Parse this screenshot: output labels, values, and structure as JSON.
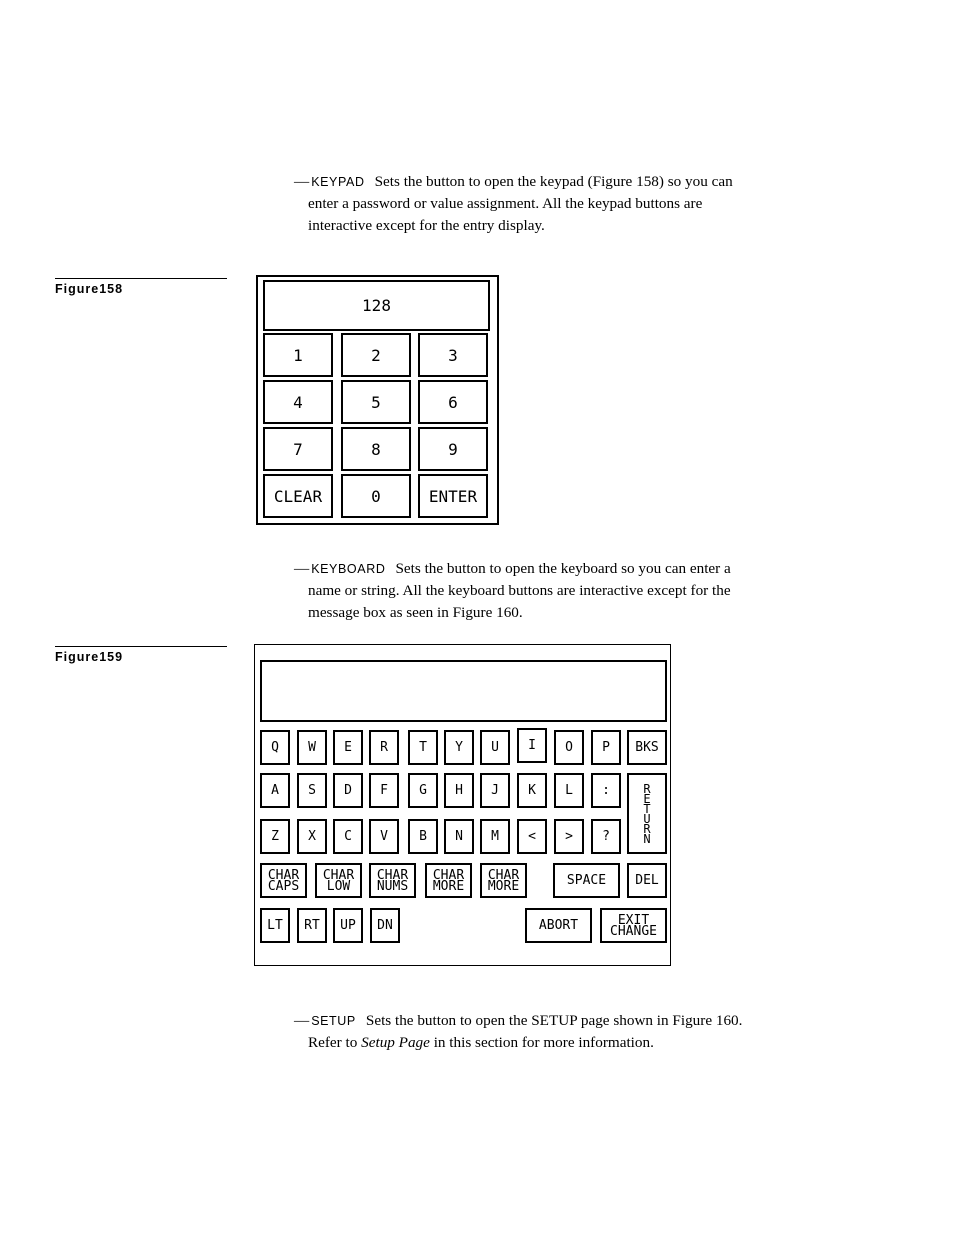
{
  "paragraphs": {
    "keypad": {
      "keyword": "KEYPAD",
      "lines": [
        "Sets the button to open the keypad (Figure 158) so you can",
        "enter a password or value assignment. All the keypad buttons are",
        "interactive except for the entry display."
      ]
    },
    "keyboard": {
      "keyword": "KEYBOARD",
      "lines": [
        "Sets the button to open the keyboard so you can enter a",
        "name or string. All the keyboard buttons are interactive except for the",
        "message box as seen in Figure 160."
      ]
    },
    "setup": {
      "keyword": "SETUP",
      "line1": "Sets the button to open the SETUP page shown in Figure 160.",
      "line2_pre": "Refer to ",
      "line2_italic": "Setup Page",
      "line2_post": " in this section for more information."
    }
  },
  "dash": "—",
  "figures": {
    "fig158": "Figure158",
    "fig159": "Figure159"
  },
  "keypad": {
    "display_value": "128",
    "keys": [
      "1",
      "2",
      "3",
      "4",
      "5",
      "6",
      "7",
      "8",
      "9",
      "CLEAR",
      "0",
      "ENTER"
    ]
  },
  "keyboard": {
    "message": "",
    "row1": [
      "Q",
      "W",
      "E",
      "R",
      "T",
      "Y",
      "U",
      "I",
      "O",
      "P",
      "BKS"
    ],
    "row2": [
      "A",
      "S",
      "D",
      "F",
      "G",
      "H",
      "J",
      "K",
      "L",
      ":"
    ],
    "row3": [
      "Z",
      "X",
      "C",
      "V",
      "B",
      "N",
      "M",
      "<",
      ">",
      "?"
    ],
    "return_letters": [
      "R",
      "E",
      "T",
      "U",
      "R",
      "N"
    ],
    "char_keys": [
      [
        "CHAR",
        "CAPS"
      ],
      [
        "CHAR",
        "LOW"
      ],
      [
        "CHAR",
        "NUMS"
      ],
      [
        "CHAR",
        "MORE"
      ],
      [
        "CHAR",
        "MORE"
      ]
    ],
    "space": "SPACE",
    "del": "DEL",
    "nav": [
      "LT",
      "RT",
      "UP",
      "DN"
    ],
    "abort": "ABORT",
    "exit_change": [
      "EXIT",
      "CHANGE"
    ]
  }
}
